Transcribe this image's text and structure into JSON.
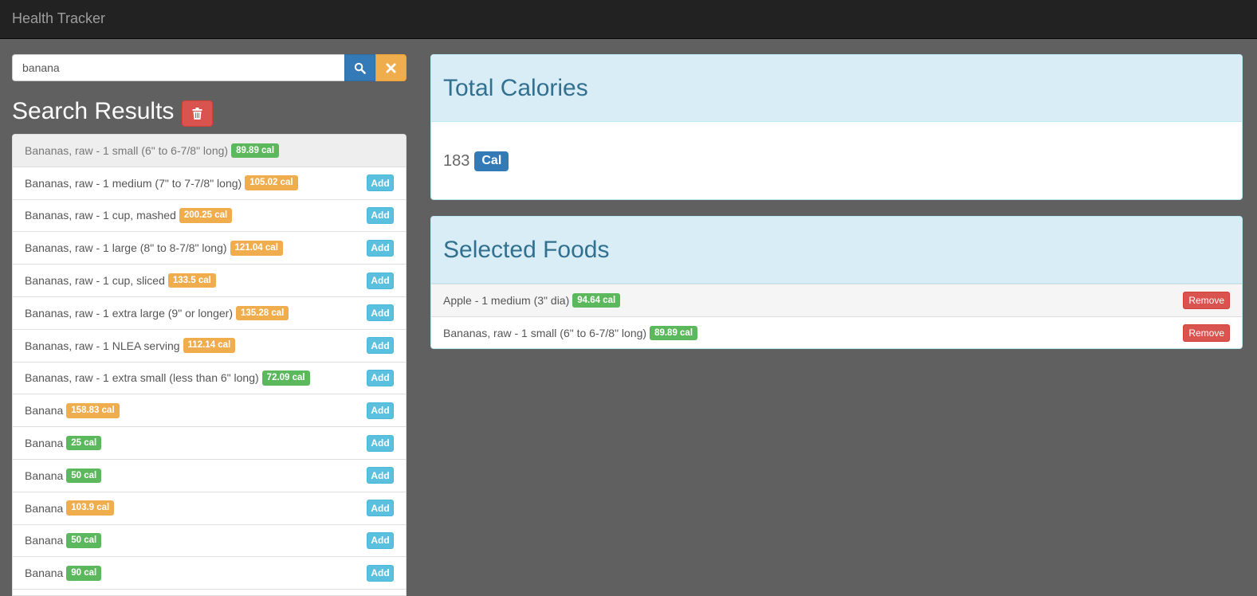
{
  "navbar": {
    "brand": "Health Tracker"
  },
  "search": {
    "value": "banana"
  },
  "results": {
    "title": "Search Results",
    "items": [
      {
        "label": "Bananas, raw - 1 small (6\" to 6-7/8\" long)",
        "cal": "89.89 cal",
        "color": "green",
        "active": true,
        "add": ""
      },
      {
        "label": "Bananas, raw - 1 medium (7\" to 7-7/8\" long)",
        "cal": "105.02 cal",
        "color": "orange",
        "active": false,
        "add": "Add"
      },
      {
        "label": "Bananas, raw - 1 cup, mashed",
        "cal": "200.25 cal",
        "color": "orange",
        "active": false,
        "add": "Add"
      },
      {
        "label": "Bananas, raw - 1 large (8\" to 8-7/8\" long)",
        "cal": "121.04 cal",
        "color": "orange",
        "active": false,
        "add": "Add"
      },
      {
        "label": "Bananas, raw - 1 cup, sliced",
        "cal": "133.5 cal",
        "color": "orange",
        "active": false,
        "add": "Add"
      },
      {
        "label": "Bananas, raw - 1 extra large (9\" or longer)",
        "cal": "135.28 cal",
        "color": "orange",
        "active": false,
        "add": "Add"
      },
      {
        "label": "Bananas, raw - 1 NLEA serving",
        "cal": "112.14 cal",
        "color": "orange",
        "active": false,
        "add": "Add"
      },
      {
        "label": "Bananas, raw - 1 extra small (less than 6\" long)",
        "cal": "72.09 cal",
        "color": "green",
        "active": false,
        "add": "Add"
      },
      {
        "label": "Banana",
        "cal": "158.83 cal",
        "color": "orange",
        "active": false,
        "add": "Add"
      },
      {
        "label": "Banana",
        "cal": "25 cal",
        "color": "green",
        "active": false,
        "add": "Add"
      },
      {
        "label": "Banana",
        "cal": "50 cal",
        "color": "green",
        "active": false,
        "add": "Add"
      },
      {
        "label": "Banana",
        "cal": "103.9 cal",
        "color": "orange",
        "active": false,
        "add": "Add"
      },
      {
        "label": "Banana",
        "cal": "50 cal",
        "color": "green",
        "active": false,
        "add": "Add"
      },
      {
        "label": "Banana",
        "cal": "90 cal",
        "color": "green",
        "active": false,
        "add": "Add"
      }
    ]
  },
  "total": {
    "title": "Total Calories",
    "value": "183",
    "unit": "Cal"
  },
  "selected": {
    "title": "Selected Foods",
    "items": [
      {
        "label": "Apple - 1 medium (3\" dia)",
        "cal": "94.64 cal",
        "color": "green",
        "remove": "Remove"
      },
      {
        "label": "Bananas, raw - 1 small (6\" to 6-7/8\" long)",
        "cal": "89.89 cal",
        "color": "green",
        "remove": "Remove"
      }
    ]
  },
  "icons": {
    "search": "search-icon",
    "clear": "close-icon",
    "delete": "trash-icon"
  },
  "colors": {
    "green": "#5cb85c",
    "orange": "#f0ad4e",
    "primary": "#337ab7",
    "danger": "#d9534f",
    "info": "#5bc0de"
  }
}
